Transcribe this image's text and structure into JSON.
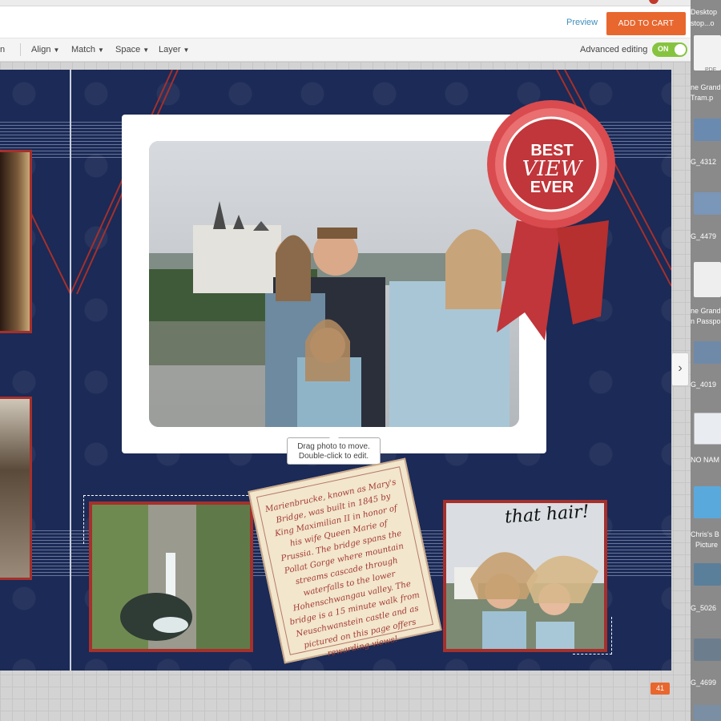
{
  "header": {
    "preview_label": "Preview",
    "cart_label": "ADD TO CART"
  },
  "toolbar": {
    "fragment": "n",
    "align": "Align",
    "match": "Match",
    "space": "Space",
    "layer": "Layer",
    "advanced_label": "Advanced editing",
    "toggle_state": "ON"
  },
  "page": {
    "badge": {
      "line1": "BEST",
      "line2": "VIEW",
      "line3": "EVER"
    },
    "tooltip": {
      "line1": "Drag photo to move.",
      "line2": "Double-click to edit."
    },
    "ticket_text": "Marienbrucke, known as Mary's Bridge, was built in 1845 by King Maximilian II in honor of his wife Queen Marie of Prussia. The bridge spans the Pollat Gorge where mountain streams cascade through waterfalls to the lower Hohenschwangau valley. The bridge is a 15 minute walk from Neuschwanstein castle and as pictured on this page offers rewarding views!",
    "photo_caption": "that hair!",
    "page_number": "41"
  },
  "desktop": {
    "items": [
      "Desktop",
      "stop...o",
      "PDF",
      "ne Grand",
      "Tram.p",
      "G_4312",
      "G_4479",
      "ne Grand",
      "n Passpo",
      "G_4019",
      "NO NAM",
      "Chris's B",
      "Picture",
      "G_5026",
      "G_4699"
    ]
  },
  "colors": {
    "accent": "#e8672f",
    "navy": "#1b2a56",
    "ribbon_red": "#c0363a",
    "frame_red": "#a5302c",
    "toggle_green": "#86c440",
    "link_blue": "#3d8fbd"
  }
}
